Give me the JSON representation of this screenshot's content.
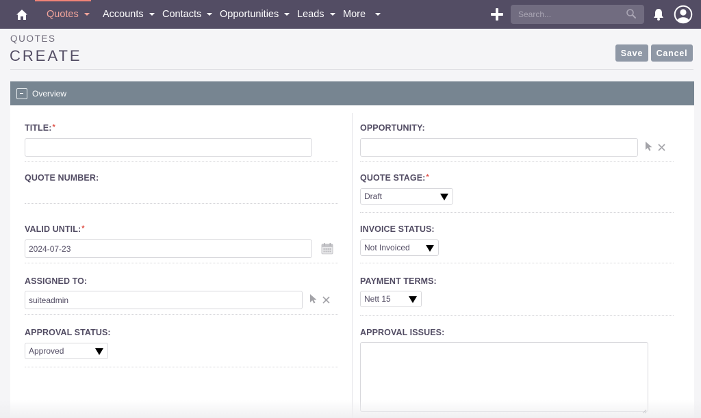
{
  "nav": {
    "items": [
      {
        "label": "Quotes",
        "active": true
      },
      {
        "label": "Accounts",
        "active": false
      },
      {
        "label": "Contacts",
        "active": false
      },
      {
        "label": "Opportunities",
        "active": false
      },
      {
        "label": "Leads",
        "active": false
      },
      {
        "label": "More",
        "active": false
      }
    ],
    "search_placeholder": "Search...",
    "icons": {
      "home": "home-icon",
      "create": "plus-icon",
      "search": "search-icon",
      "notifications": "bell-icon",
      "user": "user-avatar-icon"
    }
  },
  "header": {
    "module": "QUOTES",
    "title": "CREATE",
    "save_label": "Save",
    "cancel_label": "Cancel"
  },
  "panel": {
    "title": "Overview",
    "collapse_icon": "minus-square-icon"
  },
  "fields": {
    "title": {
      "label": "TITLE:",
      "required": true,
      "value": ""
    },
    "quote_number": {
      "label": "QUOTE NUMBER:",
      "value": ""
    },
    "valid_until": {
      "label": "VALID UNTIL:",
      "required": true,
      "value": "2024-07-23"
    },
    "assigned_to": {
      "label": "ASSIGNED TO:",
      "value": "suiteadmin"
    },
    "approval_status": {
      "label": "APPROVAL STATUS:",
      "value": "Approved"
    },
    "opportunity": {
      "label": "OPPORTUNITY:",
      "value": ""
    },
    "quote_stage": {
      "label": "QUOTE STAGE:",
      "required": true,
      "value": "Draft"
    },
    "invoice_status": {
      "label": "INVOICE STATUS:",
      "value": "Not Invoiced"
    },
    "payment_terms": {
      "label": "PAYMENT TERMS:",
      "value": "Nett 15"
    },
    "approval_issues": {
      "label": "APPROVAL ISSUES:",
      "value": ""
    }
  },
  "required_marker": "*",
  "colors": {
    "nav_bg": "#534d64",
    "nav_active": "#f3a59b",
    "panel_header": "#778591",
    "button": "#8f98a6",
    "required": "#e0534a"
  }
}
